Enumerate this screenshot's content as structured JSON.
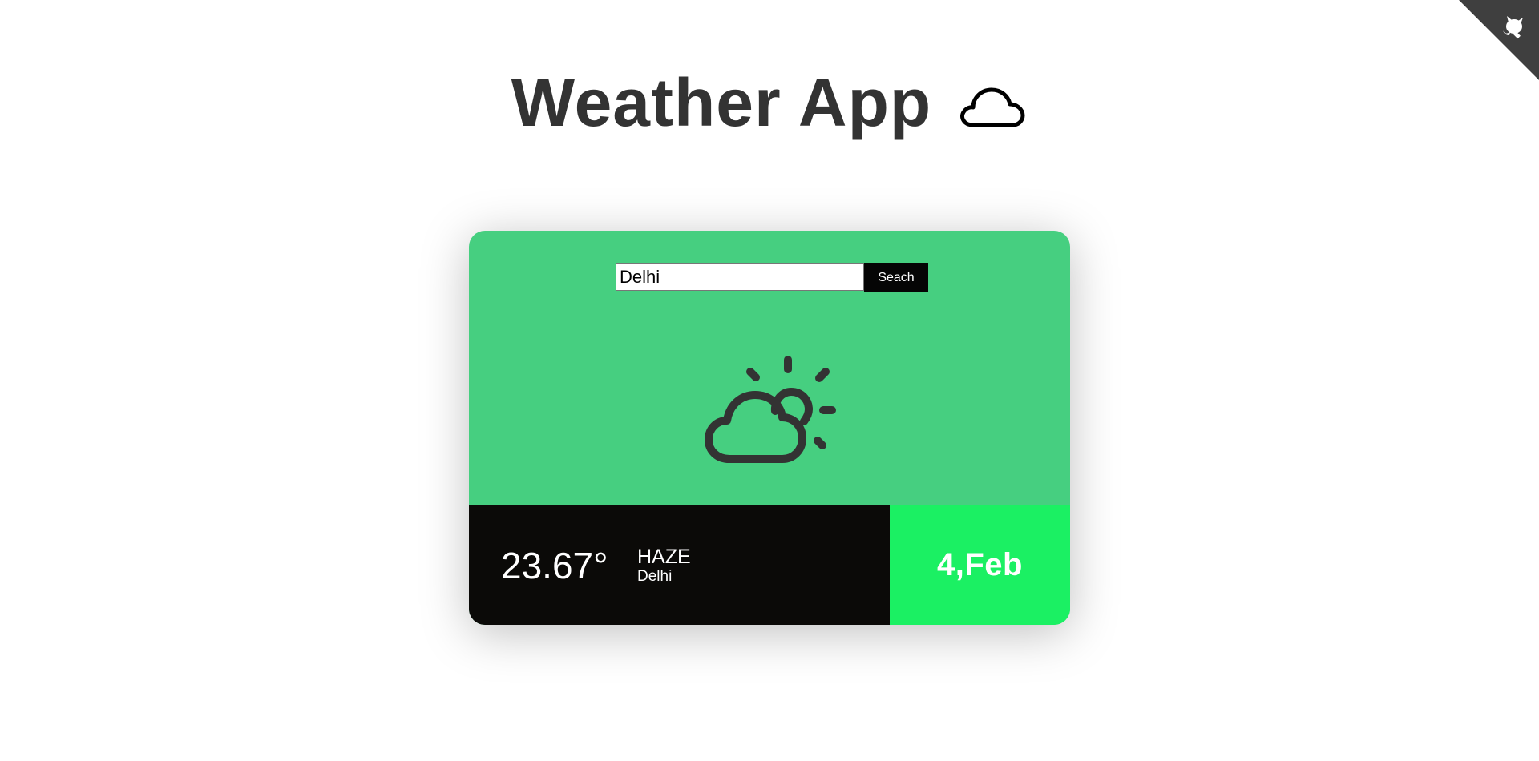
{
  "header": {
    "title": "Weather App"
  },
  "search": {
    "value": "Delhi",
    "button_label": "Seach"
  },
  "weather": {
    "icon": "partly-cloudy-icon",
    "temperature": "23.67°",
    "condition": "HAZE",
    "city": "Delhi",
    "date": "4,Feb"
  },
  "colors": {
    "card_green": "#46cf80",
    "date_green": "#1bf063",
    "info_bg": "#0b0a08",
    "title_text": "#333333",
    "github_corner": "#3f3f3f"
  }
}
